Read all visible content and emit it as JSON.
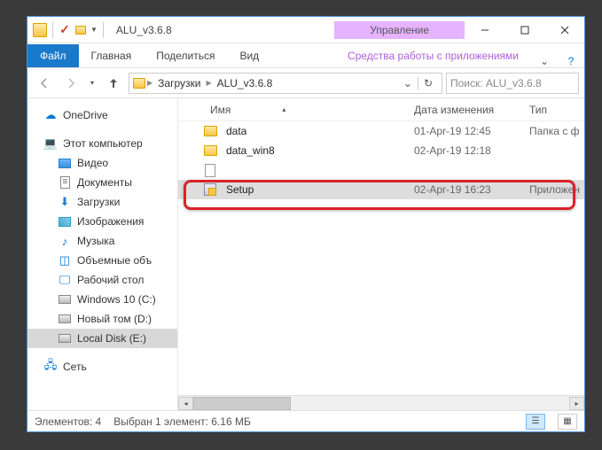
{
  "title": "ALU_v3.6.8",
  "ribbon_context": "Управление",
  "tabs": {
    "file": "Файл",
    "home": "Главная",
    "share": "Поделиться",
    "view": "Вид",
    "ctx": "Средства работы с приложениями"
  },
  "breadcrumb": [
    "Загрузки",
    "ALU_v3.6.8"
  ],
  "search_placeholder": "Поиск: ALU_v3.6.8",
  "columns": {
    "name": "Имя",
    "date": "Дата изменения",
    "type": "Тип"
  },
  "tree": {
    "onedrive": "OneDrive",
    "thispc": "Этот компьютер",
    "video": "Видео",
    "docs": "Документы",
    "downloads": "Загрузки",
    "images": "Изображения",
    "music": "Музыка",
    "objects3d": "Объемные объ",
    "desktop": "Рабочий стол",
    "c": "Windows 10 (C:)",
    "d": "Новый том (D:)",
    "e": "Local Disk (E:)",
    "network": "Сеть"
  },
  "rows": [
    {
      "name": "data",
      "date": "01-Apr-19 12:45",
      "type": "Папка с ф"
    },
    {
      "name": "data_win8",
      "date": "02-Apr-19 12:18",
      "type": ""
    },
    {
      "name": "",
      "date": "",
      "type": ""
    },
    {
      "name": "Setup",
      "date": "02-Apr-19 16:23",
      "type": "Приложен"
    }
  ],
  "status": {
    "count": "Элементов: 4",
    "selected": "Выбран 1 элемент: 6.16 МБ"
  }
}
